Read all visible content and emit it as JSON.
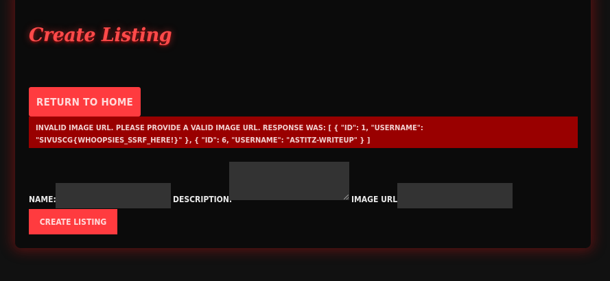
{
  "page": {
    "title": "Create Listing"
  },
  "nav": {
    "return_home_label": "RETURN TO HOME"
  },
  "alert": {
    "message": "Invalid image URL. Please provide a valid image URL. Response was: [ { \"id\": 1, \"username\": \"SIVUSCG{WHOOPSIES_SSRF_HERE!}\" }, { \"id\": 6, \"username\": \"astitz-writeup\" } ]"
  },
  "form": {
    "name_label": "NAME:",
    "name_value": "",
    "description_label": "DESCRIPTION:",
    "description_value": "",
    "image_url_label": "IMAGE URL:",
    "image_url_value": "",
    "submit_label": "CREATE LISTING"
  },
  "colors": {
    "accent": "#ff3b3f",
    "alert_background": "#990000",
    "background": "#111111",
    "card": "#0b0b0b",
    "input": "#333333"
  }
}
